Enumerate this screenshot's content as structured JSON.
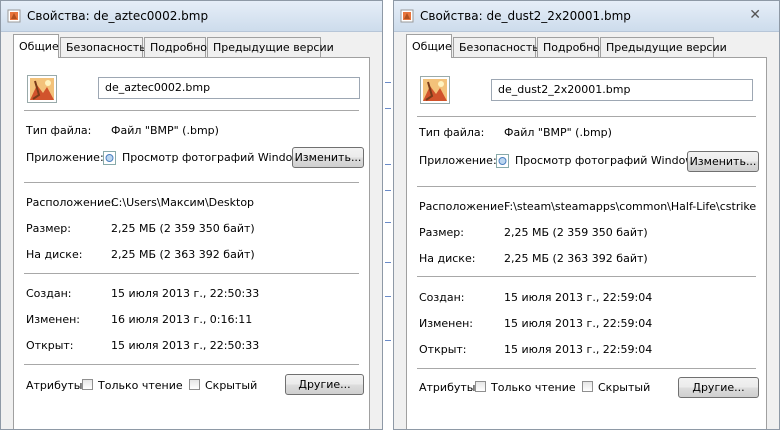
{
  "windows": [
    {
      "title": "Свойства: de_aztec0002.bmp",
      "tabs": [
        "Общие",
        "Безопасность",
        "Подробно",
        "Предыдущие версии"
      ],
      "filename": "de_aztec0002.bmp",
      "file_type_label": "Тип файла:",
      "file_type": "Файл \"BMP\" (.bmp)",
      "app_label": "Приложение:",
      "app": "Просмотр фотографий Windows",
      "change_button": "Изменить...",
      "location_label": "Расположение:",
      "location": "C:\\Users\\Максим\\Desktop",
      "size_label": "Размер:",
      "size": "2,25 МБ (2 359 350 байт)",
      "disk_label": "На диске:",
      "disk": "2,25 МБ (2 363 392 байт)",
      "created_label": "Создан:",
      "created": "15 июля 2013 г., 22:50:33",
      "modified_label": "Изменен:",
      "modified": "16 июля 2013 г., 0:16:11",
      "opened_label": "Открыт:",
      "opened": "15 июля 2013 г., 22:50:33",
      "attributes_label": "Атрибуты:",
      "readonly_label": "Только чтение",
      "hidden_label": "Скрытый",
      "other_button": "Другие..."
    },
    {
      "title": "Свойства: de_dust2_2x20001.bmp",
      "tabs": [
        "Общие",
        "Безопасность",
        "Подробно",
        "Предыдущие версии"
      ],
      "filename": "de_dust2_2x20001.bmp",
      "file_type_label": "Тип файла:",
      "file_type": "Файл \"BMP\" (.bmp)",
      "app_label": "Приложение:",
      "app": "Просмотр фотографий Windows",
      "change_button": "Изменить...",
      "location_label": "Расположение:",
      "location": "F:\\steam\\steamapps\\common\\Half-Life\\cstrike",
      "size_label": "Размер:",
      "size": "2,25 МБ (2 359 350 байт)",
      "disk_label": "На диске:",
      "disk": "2,25 МБ (2 363 392 байт)",
      "created_label": "Создан:",
      "created": "15 июля 2013 г., 22:59:04",
      "modified_label": "Изменен:",
      "modified": "15 июля 2013 г., 22:59:04",
      "opened_label": "Открыт:",
      "opened": "15 июля 2013 г., 22:59:04",
      "attributes_label": "Атрибуты:",
      "readonly_label": "Только чтение",
      "hidden_label": "Скрытый",
      "other_button": "Другие..."
    }
  ],
  "icons": {
    "title": "bmp-file-icon",
    "file": "image-file-icon",
    "app": "photo-viewer-icon",
    "close": "close-icon"
  },
  "colors": {
    "titlebar": "#dbe6f3",
    "dialog_bg": "#f0f0f0",
    "panel_bg": "#ffffff"
  }
}
